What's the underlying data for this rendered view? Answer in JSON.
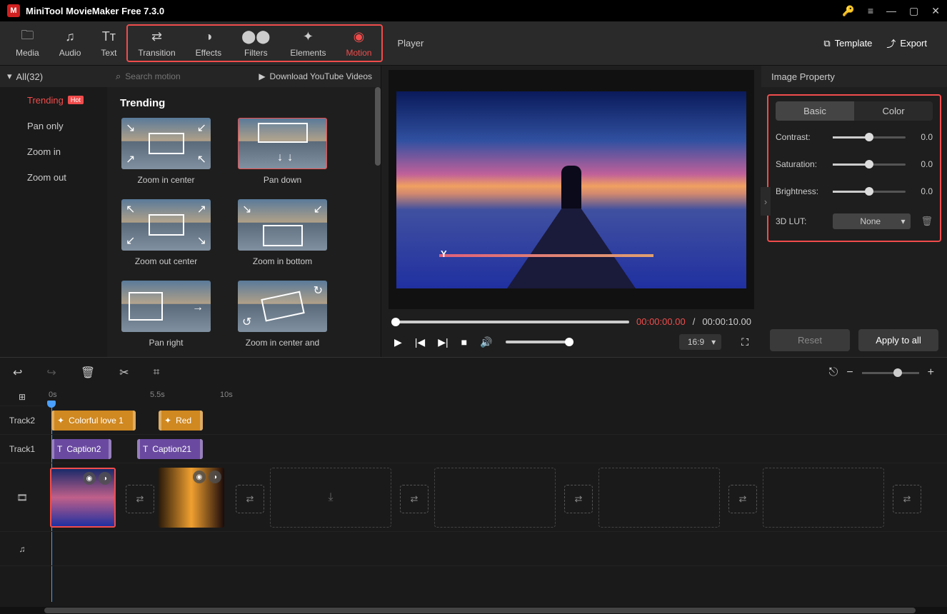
{
  "app": {
    "title": "MiniTool MovieMaker Free 7.3.0"
  },
  "toolbar": {
    "media": "Media",
    "audio": "Audio",
    "text": "Text",
    "transition": "Transition",
    "effects": "Effects",
    "filters": "Filters",
    "elements": "Elements",
    "motion": "Motion",
    "player": "Player",
    "template": "Template",
    "export": "Export"
  },
  "categories": {
    "header": "All(32)",
    "items": [
      {
        "label": "Trending",
        "hot": true
      },
      {
        "label": "Pan only"
      },
      {
        "label": "Zoom in"
      },
      {
        "label": "Zoom out"
      }
    ]
  },
  "search": {
    "placeholder": "Search motion",
    "download": "Download YouTube Videos"
  },
  "section": {
    "title": "Trending"
  },
  "thumbs": [
    {
      "label": "Zoom in center"
    },
    {
      "label": "Pan down"
    },
    {
      "label": "Zoom out center"
    },
    {
      "label": "Zoom in bottom"
    },
    {
      "label": "Pan right"
    },
    {
      "label": "Zoom in center and"
    }
  ],
  "player": {
    "current": "00:00:00.00",
    "sep": " / ",
    "total": "00:00:10.00",
    "aspect": "16:9",
    "overlay": "Y"
  },
  "property": {
    "title": "Image Property",
    "tabs": {
      "basic": "Basic",
      "color": "Color"
    },
    "contrast": {
      "label": "Contrast:",
      "value": "0.0"
    },
    "saturation": {
      "label": "Saturation:",
      "value": "0.0"
    },
    "brightness": {
      "label": "Brightness:",
      "value": "0.0"
    },
    "lut": {
      "label": "3D LUT:",
      "value": "None"
    },
    "reset": "Reset",
    "apply": "Apply to all"
  },
  "timeline": {
    "ruler": {
      "t0": "0s",
      "t1": "5.5s",
      "t2": "10s"
    },
    "tracks": {
      "t2": "Track2",
      "t1": "Track1"
    },
    "clips": {
      "orange1": "Colorful love 1",
      "orange2": "Red",
      "purple1": "Caption2",
      "purple2": "Caption21"
    }
  }
}
